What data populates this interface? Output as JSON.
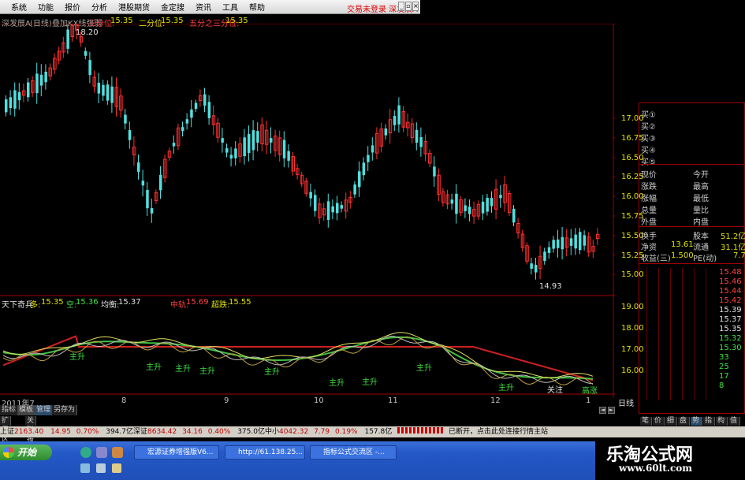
{
  "menu": [
    "系统",
    "功能",
    "报价",
    "分析",
    "港股期货",
    "金定搜",
    "资讯",
    "工具",
    "帮助"
  ],
  "trade_status": "交易未登录  深发展A",
  "chart_header": {
    "stock": "深发展A",
    "period": "(日线)",
    "overlay": "叠加KX线强弱",
    "line1_label": "三分位:",
    "line1_value": "15.35",
    "line2_label": "二分位:",
    "line2_value": "15.35",
    "line3_label": "五分之三分位:",
    "line3_value": "15.35"
  },
  "price_marks": {
    "high": "18.20",
    "low": "14.93"
  },
  "main_axis": [
    "17.00",
    "16.75",
    "16.50",
    "16.25",
    "16.00",
    "15.75",
    "15.50",
    "15.25",
    "15.00"
  ],
  "indicator_header": {
    "name": "天下奇兵",
    "duo_label": "多:",
    "duo_value": "15.35",
    "kong_label": "空:",
    "kong_value": "15.36",
    "jun_label": "均衡:",
    "jun_value": "15.37",
    "zhong_label": "中轨:",
    "zhong_value": "15.69",
    "chao_label": "超跌:",
    "chao_value": "15.55"
  },
  "indicator_axis": [
    "19.00",
    "18.00",
    "17.00",
    "16.00"
  ],
  "indicator_labels": [
    "主升",
    "主升",
    "主升",
    "主升",
    "主升",
    "主升",
    "主升",
    "主升",
    "关注",
    "主升",
    "高涨"
  ],
  "date_axis": [
    "2011年7",
    "8",
    "9",
    "10",
    "11",
    "12",
    "1"
  ],
  "period_button": "日线",
  "order_book": {
    "buys": [
      "买①",
      "买②",
      "买③",
      "买④",
      "买⑤"
    ],
    "quote_left": [
      "现价",
      "涨跌",
      "涨幅",
      "总量",
      "外盘"
    ],
    "quote_right": [
      "今开",
      "最高",
      "最低",
      "量比",
      "内盘"
    ],
    "turnover_label": "换手",
    "stock_label": "股本",
    "stock_value": "51.2亿",
    "net_label": "净资",
    "net_value": "13.61",
    "float_label": "流通",
    "float_value": "31.1亿",
    "earn_label": "收益(三)",
    "earn_value": "1.500",
    "pe_label": "PE(动)",
    "pe_value": "7.7"
  },
  "mini_axis": [
    "15.48",
    "15.46",
    "15.44",
    "15.42",
    "15.39",
    "15.37",
    "15.35",
    "15.32",
    "15.30",
    "33",
    "25",
    "17",
    "8"
  ],
  "side_tabs": [
    "笔",
    "价",
    "细",
    "盘",
    "势",
    "指",
    "构",
    "值"
  ],
  "bottom_tabs": [
    "指标",
    "模板",
    "管理",
    "另存为"
  ],
  "sub_tabs": [
    "扩展区",
    "关联报价"
  ],
  "statusbar": {
    "sh_label": "上证",
    "sh_value": "2163.40",
    "sh_change": "14.95",
    "sh_pct": "0.70%",
    "sh_amount": "394.7亿",
    "sz_label": "深证",
    "sz_value": "8634.42",
    "sz_change": "34.16",
    "sz_pct": "0.40%",
    "sz_amount": "375.0亿",
    "zx_label": "中小",
    "zx_value": "4042.32",
    "zx_change": "7.79",
    "zx_pct": "0.19%",
    "zx_amount": "157.8亿",
    "message": "已断开，点击此处连接行情主站"
  },
  "taskbar": {
    "start": "开始",
    "tasks": [
      "宏源证券增强版V6...",
      "http://61.138.25...",
      "指标公式交流区 -..."
    ]
  },
  "logo": {
    "title": "乐淘公式网",
    "url": "www.60lt.com"
  },
  "colors": {
    "up": "#ff3030",
    "down": "#50e0e0",
    "grid": "#a00000",
    "accent": "#e0e000"
  }
}
